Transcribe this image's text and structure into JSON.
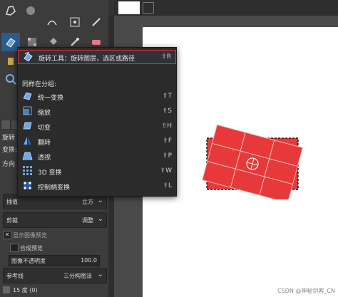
{
  "menu": {
    "highlighted": {
      "label": "旋转工具：旋转图层，选区或路径",
      "shortcut": "⇧R"
    },
    "group_header": "同样在分组:",
    "items": [
      {
        "label": "统一变换",
        "shortcut": "⇧T"
      },
      {
        "label": "缩放",
        "shortcut": "⇧S"
      },
      {
        "label": "切变",
        "shortcut": "⇧H"
      },
      {
        "label": "翻转",
        "shortcut": "⇧F"
      },
      {
        "label": "透视",
        "shortcut": "⇧P"
      },
      {
        "label": "3D 变换",
        "shortcut": "⇧W"
      },
      {
        "label": "控制柄变换",
        "shortcut": "⇧L"
      }
    ]
  },
  "options": {
    "tool_name": "旋转",
    "transform_label": "变换:",
    "direction_label": "方向",
    "interpolation_label": "插值",
    "interpolation_value": "立方",
    "clipping_label": "剪裁",
    "clipping_value": "调整",
    "show_preview": "显示图像预览",
    "composite_preview": "合成预览",
    "opacity_label": "图像不透明度",
    "opacity_value": "100.0",
    "guides_label": "参考线",
    "guides_value": "三分构图法",
    "angle_value": "15 度 (0)"
  },
  "watermark": "CSDN @神秘剑客_CN",
  "colors": {
    "accent_border": "#e0303a",
    "shape_fill": "#e8393a",
    "menu_bg": "#2b2b2b",
    "toolbox_bg": "#3c3c3c"
  }
}
